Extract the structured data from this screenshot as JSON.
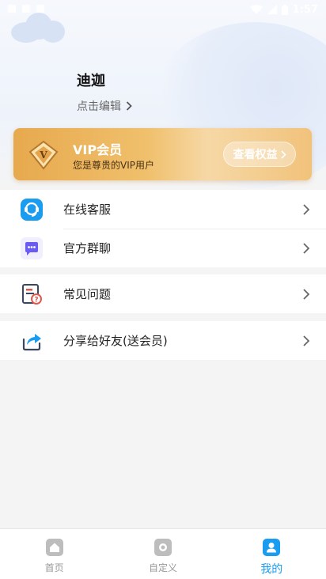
{
  "status_bar": {
    "time": "1:57"
  },
  "profile": {
    "name": "迪迦",
    "edit_label": "点击编辑"
  },
  "vip": {
    "title": "VIP会员",
    "subtitle": "您是尊贵的VIP用户",
    "button_label": "查看权益",
    "badge_letter": "V"
  },
  "menu_groups": [
    [
      {
        "label": "在线客服",
        "icon": "headset-icon"
      },
      {
        "label": "官方群聊",
        "icon": "chat-bubble-icon"
      }
    ],
    [
      {
        "label": "常见问题",
        "icon": "faq-document-icon"
      }
    ],
    [
      {
        "label": "分享给好友(送会员)",
        "icon": "share-icon"
      }
    ]
  ],
  "tabs": [
    {
      "label": "首页",
      "icon": "home-icon",
      "active": false
    },
    {
      "label": "自定义",
      "icon": "custom-icon",
      "active": false
    },
    {
      "label": "我的",
      "icon": "profile-icon",
      "active": true
    }
  ],
  "colors": {
    "accent": "#1a9cf0",
    "vip_gold": "#e7a94e",
    "chat_purple": "#6a5cf2"
  }
}
